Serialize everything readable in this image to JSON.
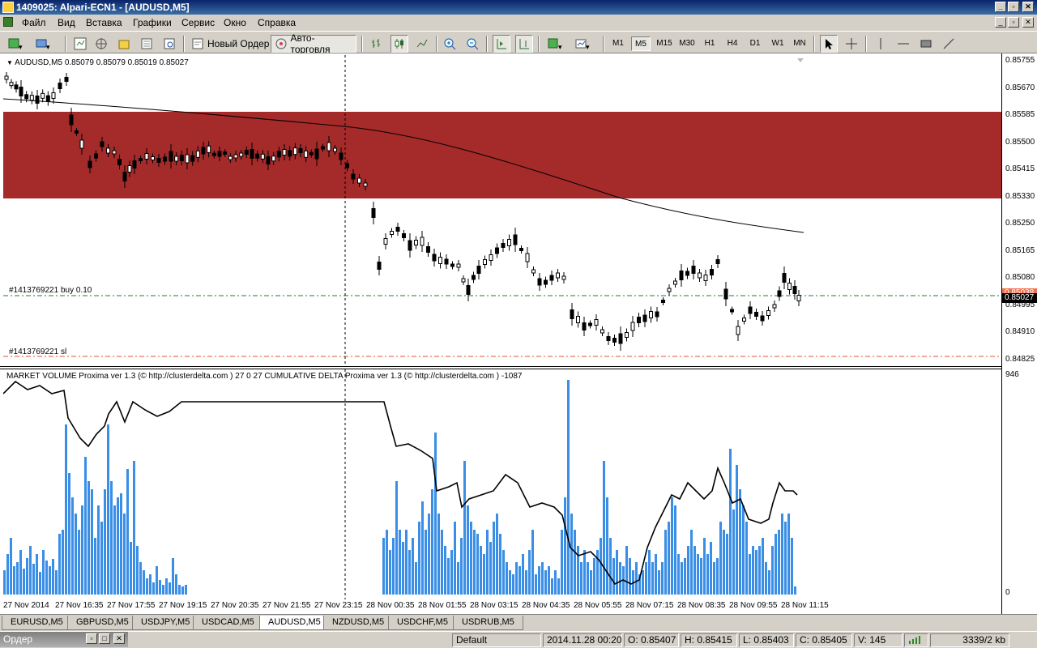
{
  "window": {
    "title": "1409025: Alpari-ECN1 - [AUDUSD,M5]",
    "minimize": "_",
    "restore": "▫",
    "close": "✕"
  },
  "menu": {
    "items": [
      {
        "label": "Файл"
      },
      {
        "label": "Вид"
      },
      {
        "label": "Вставка"
      },
      {
        "label": "Графики"
      },
      {
        "label": "Сервис"
      },
      {
        "label": "Окно"
      },
      {
        "label": "Справка"
      }
    ]
  },
  "toolbar": {
    "new_order": "Новый Ордер",
    "auto_trading": "Авто-торговля",
    "timeframes": [
      "M1",
      "M5",
      "M15",
      "M30",
      "H1",
      "H4",
      "D1",
      "W1",
      "MN"
    ],
    "active_timeframe": "M5"
  },
  "chart": {
    "symbol_header": "AUDUSD,M5  0.85079 0.85079 0.85019 0.85027",
    "price_ticks": [
      "0.85755",
      "0.85670",
      "0.85585",
      "0.85500",
      "0.85415",
      "0.85330",
      "0.85250",
      "0.85165",
      "0.85080",
      "0.84995",
      "0.84910",
      "0.84825"
    ],
    "current_price": "0.85027",
    "order_price_label": "0.85038",
    "buy_order_label": "#1413769221 buy 0.10",
    "sl_label": "#1413769221 sl",
    "zone_color": "#a52a2a",
    "candle_color": "#000000"
  },
  "indicator": {
    "header": "MARKET VOLUME Proxima ver 1.3 (© http://clusterdelta.com ) 27 0 27  CUMULATIVE DELTA Proxima ver 1.3 (© http://clusterdelta.com ) -1087",
    "max_label": "946",
    "min_label": "0",
    "bar_color": "#3a8ee6"
  },
  "time_axis": [
    "27 Nov 2014",
    "27 Nov 16:35",
    "27 Nov 17:55",
    "27 Nov 19:15",
    "27 Nov 20:35",
    "27 Nov 21:55",
    "27 Nov 23:15",
    "28 Nov 00:35",
    "28 Nov 01:55",
    "28 Nov 03:15",
    "28 Nov 04:35",
    "28 Nov 05:55",
    "28 Nov 07:15",
    "28 Nov 08:35",
    "28 Nov 09:55",
    "28 Nov 11:15"
  ],
  "tabs": [
    {
      "label": "EURUSD,M5"
    },
    {
      "label": "GBPUSD,M5"
    },
    {
      "label": "USDJPY,M5"
    },
    {
      "label": "USDCAD,M5"
    },
    {
      "label": "AUDUSD,M5",
      "active": true
    },
    {
      "label": "NZDUSD,M5"
    },
    {
      "label": "USDCHF,M5"
    },
    {
      "label": "USDRUB,M5"
    }
  ],
  "status": {
    "panel_title": "Ордер",
    "profile": "Default",
    "datetime": "2014.11.28 00:20",
    "open": "O: 0.85407",
    "high": "H: 0.85415",
    "low": "L: 0.85403",
    "close": "C: 0.85405",
    "volume": "V: 145",
    "traffic": "3339/2 kb"
  }
}
